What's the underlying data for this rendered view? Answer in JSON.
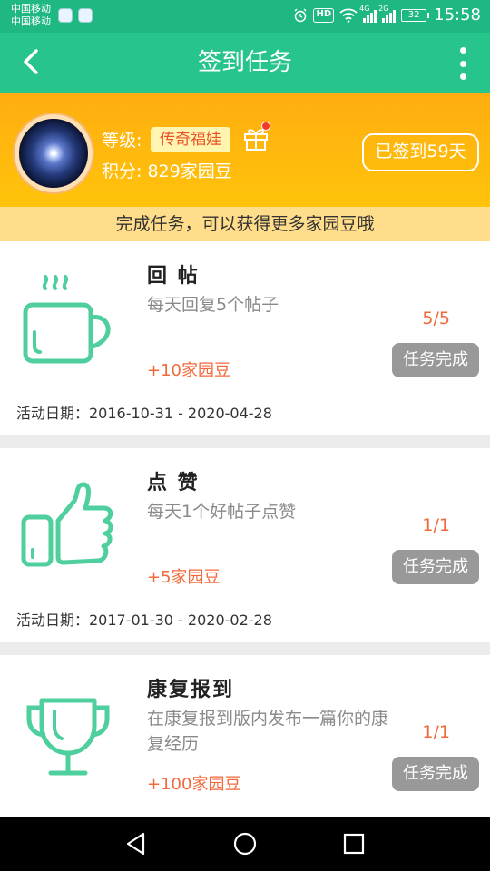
{
  "status_bar": {
    "carrier_1": "中国移动",
    "carrier_2": "中国移动",
    "hd": "HD",
    "net_1": "4G",
    "net_2": "2G",
    "battery": "32",
    "time": "15:58"
  },
  "header": {
    "title": "签到任务"
  },
  "profile": {
    "level_label": "等级:",
    "level_value": "传奇福娃",
    "points_label": "积分:",
    "points_value": "829家园豆",
    "checkin_status": "已签到59天"
  },
  "banner": "完成任务，可以获得更多家园豆哦",
  "tasks": [
    {
      "name": "回 帖",
      "desc": "每天回复5个帖子",
      "reward": "+10家园豆",
      "progress": "5/5",
      "button": "任务完成",
      "date": "活动日期：2016-10-31 - 2020-04-28",
      "icon": "coffee-cup-icon"
    },
    {
      "name": "点 赞",
      "desc": "每天1个好帖子点赞",
      "reward": "+5家园豆",
      "progress": "1/1",
      "button": "任务完成",
      "date": "活动日期：2017-01-30 - 2020-02-28",
      "icon": "thumbs-up-icon"
    },
    {
      "name": "康复报到",
      "desc": "在康复报到版内发布一篇你的康复经历",
      "reward": "+100家园豆",
      "progress": "1/1",
      "button": "任务完成",
      "icon": "trophy-icon"
    }
  ],
  "colors": {
    "header": "#27c48b",
    "profile": "#ffb30e",
    "icon_green": "#4fcf9d",
    "reward_orange": "#f26a3c"
  }
}
